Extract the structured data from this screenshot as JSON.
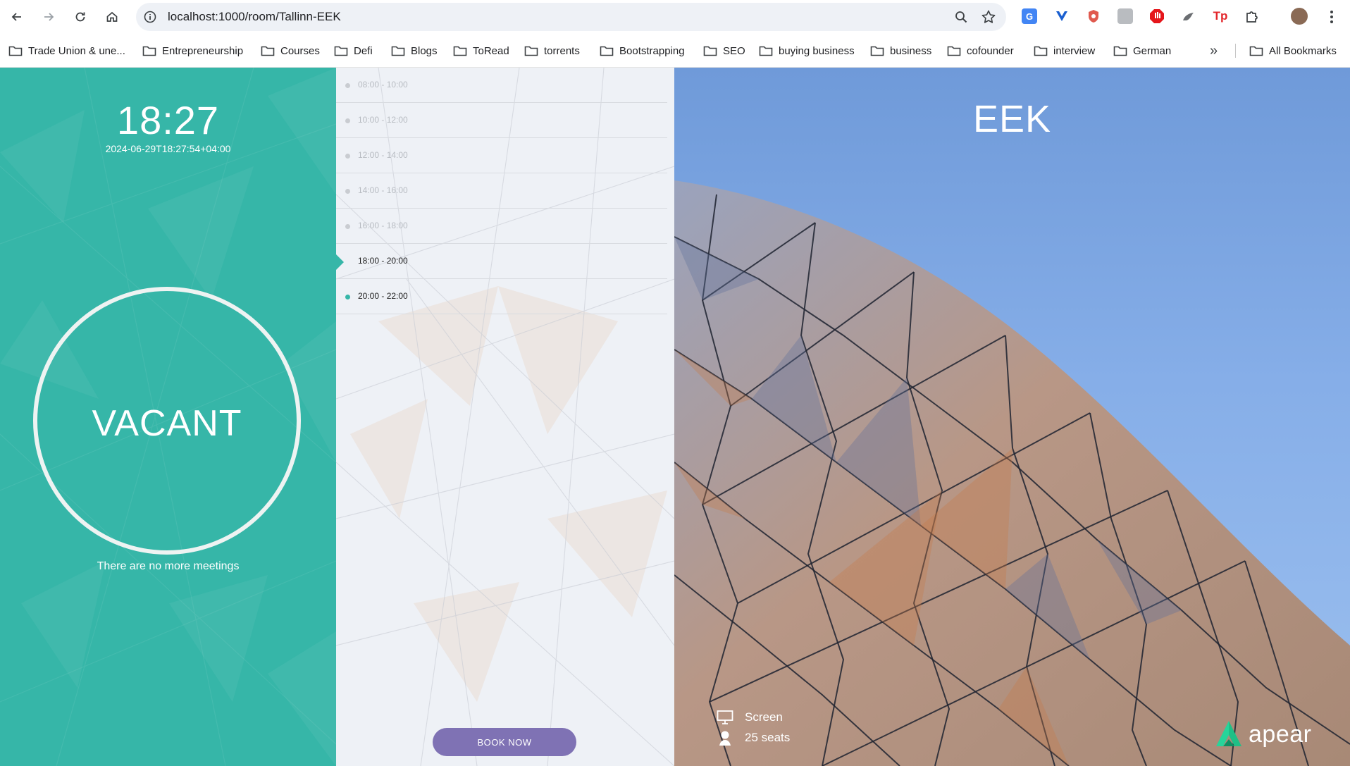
{
  "browser": {
    "url": "localhost:1000/room/Tallinn-EEK",
    "bookmarks": [
      "Trade Union & une...",
      "Entrepreneurship",
      "Courses",
      "Defi",
      "Blogs",
      "ToRead",
      "torrents",
      "Bootstrapping",
      "SEO",
      "buying business",
      "business",
      "cofounder",
      "interview",
      "German"
    ],
    "overflow_label": "»",
    "all_bookmarks_label": "All Bookmarks"
  },
  "clock": {
    "time": "18:27",
    "iso": "2024-06-29T18:27:54+04:00"
  },
  "status": {
    "label": "VACANT",
    "message": "There are no more meetings",
    "color": "#36b6a8"
  },
  "schedule": {
    "slots": [
      {
        "label": "08:00 - 10:00",
        "state": "past"
      },
      {
        "label": "10:00 - 12:00",
        "state": "past"
      },
      {
        "label": "12:00 - 14:00",
        "state": "past"
      },
      {
        "label": "14:00 - 16:00",
        "state": "past"
      },
      {
        "label": "16:00 - 18:00",
        "state": "past"
      },
      {
        "label": "18:00 - 20:00",
        "state": "current"
      },
      {
        "label": "20:00 - 22:00",
        "state": "next"
      }
    ],
    "book_button": "BOOK NOW",
    "book_color": "#7f72b4"
  },
  "room": {
    "name": "EEK",
    "amenities": [
      {
        "icon": "monitor-icon",
        "label": "Screen"
      },
      {
        "icon": "person-icon",
        "label": "25 seats"
      }
    ],
    "brand": "apear"
  }
}
